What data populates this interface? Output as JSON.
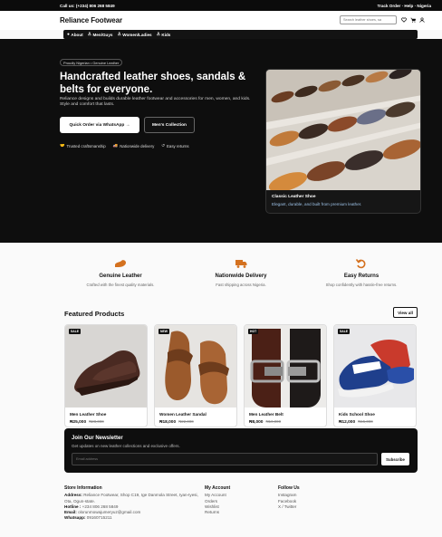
{
  "topbar": {
    "call": "Call us: (+234) 806 268 5849",
    "links": "Track Order · Help · Nigeria"
  },
  "header": {
    "brand": "Reliance Footwear",
    "search_placeholder": "Search leather shoes, sa",
    "icons": [
      "heart-icon",
      "cart-icon",
      "user-icon"
    ]
  },
  "nav": {
    "items": [
      {
        "icon": "info-icon",
        "label": "About"
      },
      {
        "icon": "man-icon",
        "label": "Men/Guys"
      },
      {
        "icon": "woman-icon",
        "label": "Women/Ladies"
      },
      {
        "icon": "child-icon",
        "label": "Kids"
      }
    ]
  },
  "hero": {
    "badge": "Proudly Nigerian • Genuine Leather",
    "title": "Handcrafted leather shoes, sandals & belts for everyone.",
    "description": "Reliance designs and builds durable leather footwear and accessories for men, women, and kids. Style and comfort that lasts.",
    "cta_primary": "Quick Order via WhatsApp →",
    "cta_secondary": "Men's Collection",
    "features": [
      "Trusted craftsmanship",
      "Nationwide delivery",
      "Easy returns"
    ],
    "card_title": "Classic Leather Shoe",
    "card_subtitle": "Elegant, durable, and built from premium leather."
  },
  "features": [
    {
      "icon": "leather-icon",
      "title": "Genuine Leather",
      "subtitle": "Crafted with the finest quality materials."
    },
    {
      "icon": "truck-icon",
      "title": "Nationwide Delivery",
      "subtitle": "Fast shipping across Nigeria."
    },
    {
      "icon": "return-icon",
      "title": "Easy Returns",
      "subtitle": "Shop confidently with hassle-free returns."
    }
  ],
  "products": {
    "title": "Featured Products",
    "view_all": "View all",
    "items": [
      {
        "tag": "SALE",
        "name": "Men Leather Shoe",
        "price": "₦25,000",
        "old_price": "₦28,000"
      },
      {
        "tag": "NEW",
        "name": "Women Leather Sandal",
        "price": "₦18,000",
        "old_price": "₦22,000"
      },
      {
        "tag": "HOT",
        "name": "Men Leather Belt",
        "price": "₦8,000",
        "old_price": "₦10,000"
      },
      {
        "tag": "SALE",
        "name": "Kids School Shoe",
        "price": "₦12,000",
        "old_price": "₦15,000"
      }
    ]
  },
  "newsletter": {
    "title": "Join Our Newsletter",
    "subtitle": "Get updates on new leather collections and exclusive offers.",
    "placeholder": "Email address",
    "button": "Subscribe"
  },
  "footer": {
    "store_title": "Store Information",
    "address_label": "Address:",
    "address": "Reliance Footwear, Shop C19, Ige Danmola Street, Iyan-Iyesi, Ota, Ogun-state.",
    "hotline_label": "Hotline :",
    "hotline": "+234 806 268 5849",
    "email_label": "Email:",
    "email": "olorunmowajumeryuz@gmail.com",
    "whatsapp_label": "Whatsapp:",
    "whatsapp": "09160715211",
    "account_title": "My Account",
    "account_links": [
      "My Account",
      "Orders",
      "Wishlist",
      "Returns"
    ],
    "follow_title": "Follow Us",
    "follow_links": [
      "Instagram",
      "Facebook",
      "X / Twitter"
    ]
  }
}
